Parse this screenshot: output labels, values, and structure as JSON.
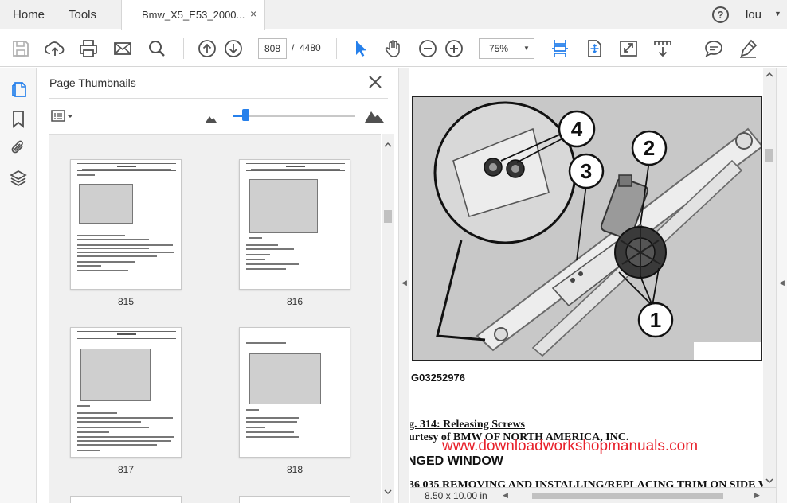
{
  "tabbar": {
    "home": "Home",
    "tools": "Tools",
    "document_tab": "Bmw_X5_E53_2000...",
    "close_glyph": "×",
    "help_glyph": "?",
    "user": "lou",
    "user_caret": "▼"
  },
  "toolbar": {
    "current_page": "808",
    "page_separator": "/",
    "total_pages": "4480",
    "zoom": "75%",
    "zoom_caret": "▼",
    "accent_color": "#2680eb",
    "icons": [
      "save-icon",
      "upload-cloud-icon",
      "print-icon",
      "email-icon",
      "search-icon",
      "previous-page-icon",
      "next-page-icon",
      "select-cursor-icon",
      "hand-tool-icon",
      "zoom-out-icon",
      "zoom-in-icon",
      "scrolling-mode-icon",
      "fit-page-icon",
      "full-screen-icon",
      "read-mode-icon",
      "comment-icon",
      "sign-pen-icon"
    ]
  },
  "left_rail": {
    "icons": [
      "page-thumbnails-icon",
      "bookmarks-icon",
      "attachments-icon",
      "layers-icon"
    ]
  },
  "thumbnails_panel": {
    "title": "Page Thumbnails",
    "thumbnail_size_level": 0.1,
    "pages": [
      {
        "number": "815"
      },
      {
        "number": "816"
      },
      {
        "number": "817"
      },
      {
        "number": "818"
      }
    ]
  },
  "document": {
    "figure_callouts": [
      "4",
      "3",
      "2",
      "1"
    ],
    "figure_code": "G03252976",
    "caption": "g. 314: Releasing Screws",
    "courtesy": "urtesy of BMW OF NORTH AMERICA, INC.",
    "watermark": "www.downloadworkshopmanuals.com",
    "watermark_color": "#e8202a",
    "section_heading": "NGED WINDOW",
    "procedure_line": "36 035 REMOVING AND INSTALLING/REPLACING TRIM ON SIDE W"
  },
  "statusbar": {
    "page_size": "8.50 x 10.00 in"
  }
}
